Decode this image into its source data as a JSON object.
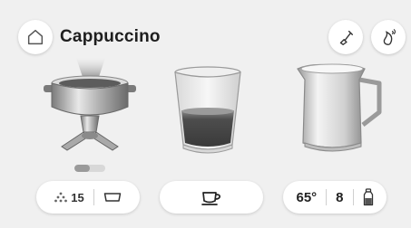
{
  "header": {
    "title": "Cappuccino",
    "home_icon": "home-icon",
    "clean_icon": "brush-icon",
    "steam_icon": "steam-icon"
  },
  "stages": [
    {
      "name": "grinder-portafilter",
      "icon": "portafilter-icon"
    },
    {
      "name": "espresso-glass",
      "icon": "glass-icon"
    },
    {
      "name": "milk-jug",
      "icon": "milk-jug-icon"
    }
  ],
  "pager": {
    "current": 1,
    "total": 2
  },
  "controls": {
    "grind": {
      "value": "15",
      "icon": "grind-dots-icon",
      "basket_icon": "basket-icon"
    },
    "extract": {
      "icon": "cup-icon"
    },
    "milk": {
      "temperature": "65°",
      "foam_level": "8",
      "icon": "milk-bottle-icon"
    }
  },
  "colors": {
    "background": "#f0f0f0",
    "button": "#ffffff",
    "text": "#222222"
  }
}
